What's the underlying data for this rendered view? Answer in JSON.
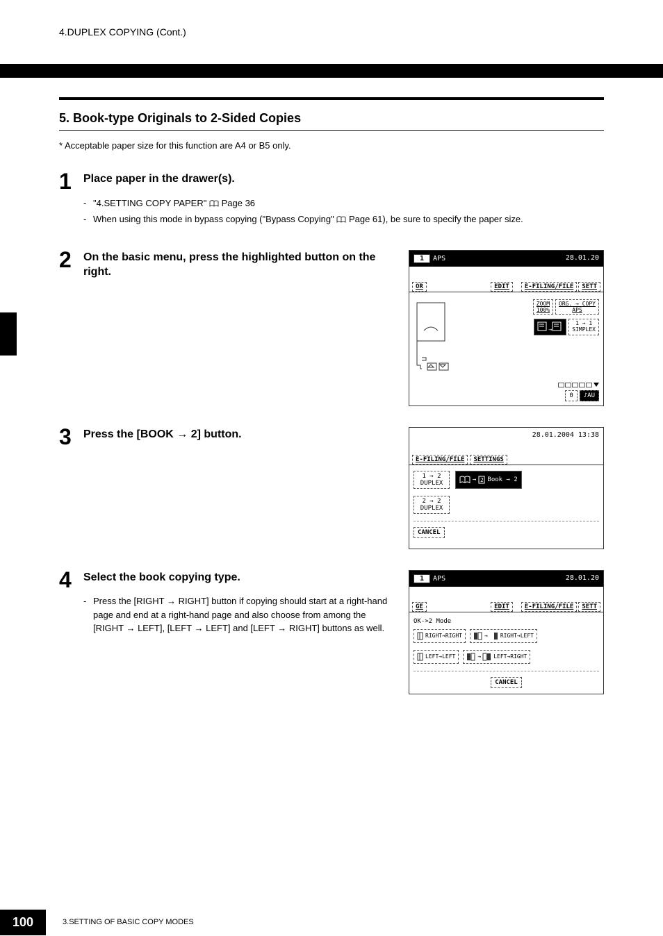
{
  "header": {
    "title": "4.DUPLEX COPYING (Cont.)"
  },
  "section": {
    "number": "5.",
    "title": "Book-type Originals to 2-Sided Copies"
  },
  "note": "*   Acceptable paper size for this function are A4 or B5 only.",
  "steps": [
    {
      "num": "1",
      "heading": "Place paper in the drawer(s).",
      "sub": [
        {
          "pre": "\"4.SETTING COPY PAPER\"",
          "post": "Page 36"
        },
        {
          "pre": "When using this mode in bypass copying (\"Bypass Copying\"",
          "post": "Page 61), be sure to specify the paper size."
        }
      ]
    },
    {
      "num": "2",
      "heading": "On the basic menu, press the highlighted button on the right."
    },
    {
      "num": "3",
      "heading_pre": "Press the [BOOK",
      "heading_post": "2] button."
    },
    {
      "num": "4",
      "heading": "Select the book copying type.",
      "sub_desc_parts": [
        "Press the [RIGHT",
        "RIGHT] button if copying should start at a right-hand page and end at a right-hand page and also choose from among the [RIGHT",
        "LEFT], [LEFT",
        "LEFT] and [LEFT",
        "RIGHT] buttons as well."
      ]
    }
  ],
  "screen1": {
    "count": "1",
    "aps": "APS",
    "date": "28.01.20",
    "tabs": {
      "or": "OR",
      "edit": "EDIT",
      "efiling": "E-FILING/FILE",
      "sett": "SETT"
    },
    "zoom_label": "ZOOM",
    "zoom_val": "100%",
    "orig_label": "ORG.",
    "copy_label": "COPY",
    "aps2": "APS",
    "simplex_mode": "1 → 1",
    "simplex": "SIMPLEX",
    "zero": "0",
    "au": "AU"
  },
  "screen2": {
    "date": "28.01.2004 13:38",
    "tabs": {
      "efiling": "E-FILING/FILE",
      "settings": "SETTINGS"
    },
    "opt1": "1 → 2",
    "opt1b": "DUPLEX",
    "opt2": "Book → 2",
    "opt3": "2 → 2",
    "opt3b": "DUPLEX",
    "cancel": "CANCEL"
  },
  "screen3": {
    "count": "1",
    "aps": "APS",
    "date": "28.01.20",
    "tabs": {
      "ge": "GE",
      "edit": "EDIT",
      "efiling": "E-FILING/FILE",
      "sett": "SETT"
    },
    "mode": "OK->2 Mode",
    "rr": "RIGHT→RIGHT",
    "rl": "RIGHT→LEFT",
    "ll": "LEFT→LEFT",
    "lr": "LEFT→RIGHT",
    "cancel": "CANCEL"
  },
  "footer": {
    "page": "100",
    "chapter": "3.SETTING OF BASIC COPY MODES"
  }
}
